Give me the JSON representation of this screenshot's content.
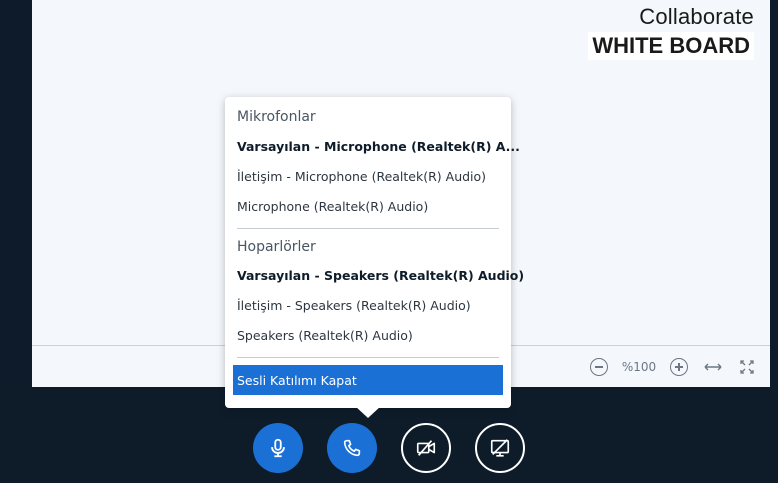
{
  "brand": {
    "line1": "Collaborate",
    "line2": "WHITE BOARD"
  },
  "zoom": {
    "level": "%100"
  },
  "audio_menu": {
    "microphones": {
      "title": "Mikrofonlar",
      "items": [
        {
          "label": "Varsayılan - Microphone (Realtek(R) A...",
          "selected": true
        },
        {
          "label": "İletişim - Microphone (Realtek(R) Audio)",
          "selected": false
        },
        {
          "label": "Microphone (Realtek(R) Audio)",
          "selected": false
        }
      ]
    },
    "speakers": {
      "title": "Hoparlörler",
      "items": [
        {
          "label": "Varsayılan - Speakers (Realtek(R) Audio)",
          "selected": true
        },
        {
          "label": "İletişim - Speakers (Realtek(R) Audio)",
          "selected": false
        },
        {
          "label": "Speakers (Realtek(R) Audio)",
          "selected": false
        }
      ]
    },
    "leave_audio": "Sesli Katılımı Kapat"
  },
  "controls": {
    "buttons": [
      "microphone-icon",
      "phone-icon",
      "camera-off-icon",
      "screen-share-off-icon"
    ]
  },
  "colors": {
    "accent": "#1b70d6",
    "dark_background": "#0e1c2a",
    "canvas": "#f4f7fb"
  }
}
